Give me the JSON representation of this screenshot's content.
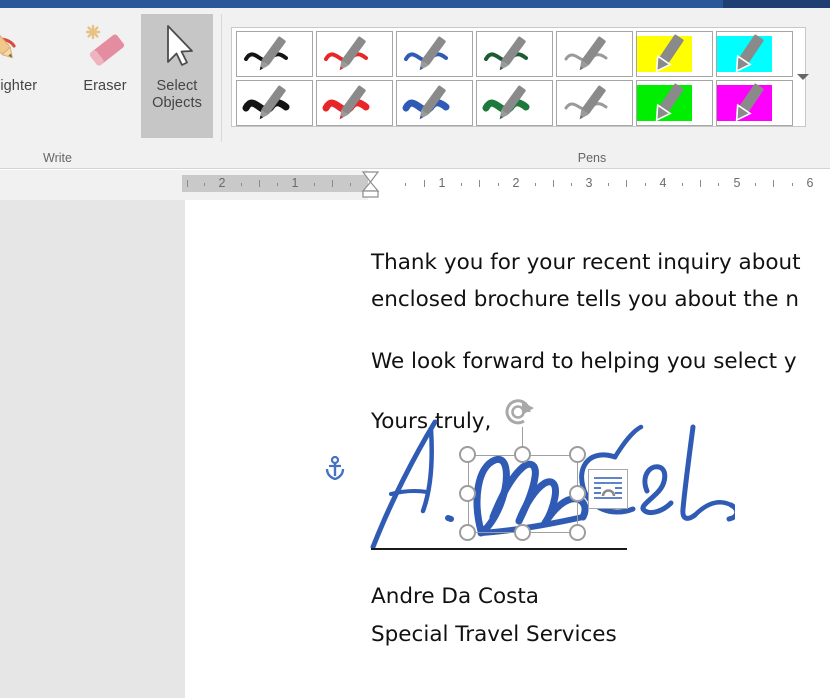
{
  "window": {
    "accent_color": "#2b579a",
    "accent_dark": "#1f3f73"
  },
  "ribbon": {
    "groups": [
      {
        "name": "write",
        "label": "Write",
        "buttons": [
          {
            "id": "highlighter",
            "label": "Highlighter",
            "icon": "highlighter-pen-icon",
            "active": false
          },
          {
            "id": "eraser",
            "label": "Eraser",
            "icon": "eraser-icon",
            "active": false
          },
          {
            "id": "select-objects",
            "label": "Select\nObjects",
            "label_line1": "Select",
            "label_line2": "Objects",
            "icon": "arrow-cursor-icon",
            "active": true
          }
        ]
      },
      {
        "name": "pens",
        "label": "Pens",
        "more_button": {
          "label": "More",
          "icon": "chevron-down-icon"
        },
        "items": [
          {
            "id": "pen-black-thin",
            "type": "pen",
            "color": "#141414",
            "thickness": 4,
            "row": 1,
            "col": 1
          },
          {
            "id": "pen-red-thin",
            "type": "pen",
            "color": "#e8262a",
            "thickness": 4,
            "row": 1,
            "col": 2
          },
          {
            "id": "pen-blue-thin",
            "type": "pen",
            "color": "#2f5bb5",
            "thickness": 4,
            "row": 1,
            "col": 3
          },
          {
            "id": "pen-green-thin",
            "type": "pen",
            "color": "#1e5b33",
            "thickness": 4,
            "row": 1,
            "col": 4
          },
          {
            "id": "pen-gray-thin",
            "type": "pen",
            "color": "#9a9a9a",
            "thickness": 3,
            "row": 1,
            "col": 5
          },
          {
            "id": "highlighter-yellow",
            "type": "highlighter",
            "color": "#ffff00",
            "row": 1,
            "col": 6
          },
          {
            "id": "highlighter-cyan",
            "type": "highlighter",
            "color": "#00ffff",
            "row": 1,
            "col": 7
          },
          {
            "id": "pen-black-thick",
            "type": "pen",
            "color": "#141414",
            "thickness": 7,
            "row": 2,
            "col": 1
          },
          {
            "id": "pen-red-thick",
            "type": "pen",
            "color": "#e8262a",
            "thickness": 7,
            "row": 2,
            "col": 2
          },
          {
            "id": "pen-blue-thick",
            "type": "pen",
            "color": "#2f5bb5",
            "thickness": 7,
            "row": 2,
            "col": 3
          },
          {
            "id": "pen-green-thick",
            "type": "pen",
            "color": "#1e7a3c",
            "thickness": 7,
            "row": 2,
            "col": 4
          },
          {
            "id": "pen-gray-thick",
            "type": "pen",
            "color": "#9a9a9a",
            "thickness": 3,
            "row": 2,
            "col": 5
          },
          {
            "id": "highlighter-green",
            "type": "highlighter",
            "color": "#00ee00",
            "row": 2,
            "col": 6
          },
          {
            "id": "highlighter-magenta",
            "type": "highlighter",
            "color": "#ff00ff",
            "row": 2,
            "col": 7
          }
        ]
      }
    ]
  },
  "ruler": {
    "unit": "inch",
    "left_ticks": [
      "2",
      "1"
    ],
    "right_ticks": [
      "1",
      "2",
      "3",
      "4",
      "5",
      "6"
    ],
    "indent_markers": [
      "first-line-indent",
      "hanging-indent",
      "left-indent"
    ]
  },
  "document": {
    "paragraphs": [
      {
        "id": "p1-line1",
        "text": "Thank you for your recent inquiry about"
      },
      {
        "id": "p1-line2",
        "text": "enclosed brochure tells you about the n"
      },
      {
        "id": "p2-line1",
        "text": "We look forward to helping you select y"
      },
      {
        "id": "p3-line1",
        "text": "Yours truly,"
      },
      {
        "id": "p4-line1",
        "text": "Andre Da Costa"
      },
      {
        "id": "p4-line2",
        "text": "Special Travel Services"
      }
    ],
    "signature": {
      "alt": "A. Da Costa handwritten ink signature",
      "ink_color": "#2f5bb5",
      "underline_color": "#1a1a1a"
    },
    "selection": {
      "handles": 8,
      "rotate_handle": true,
      "anchor": true,
      "layout_options_button": "layout-options-icon"
    }
  }
}
